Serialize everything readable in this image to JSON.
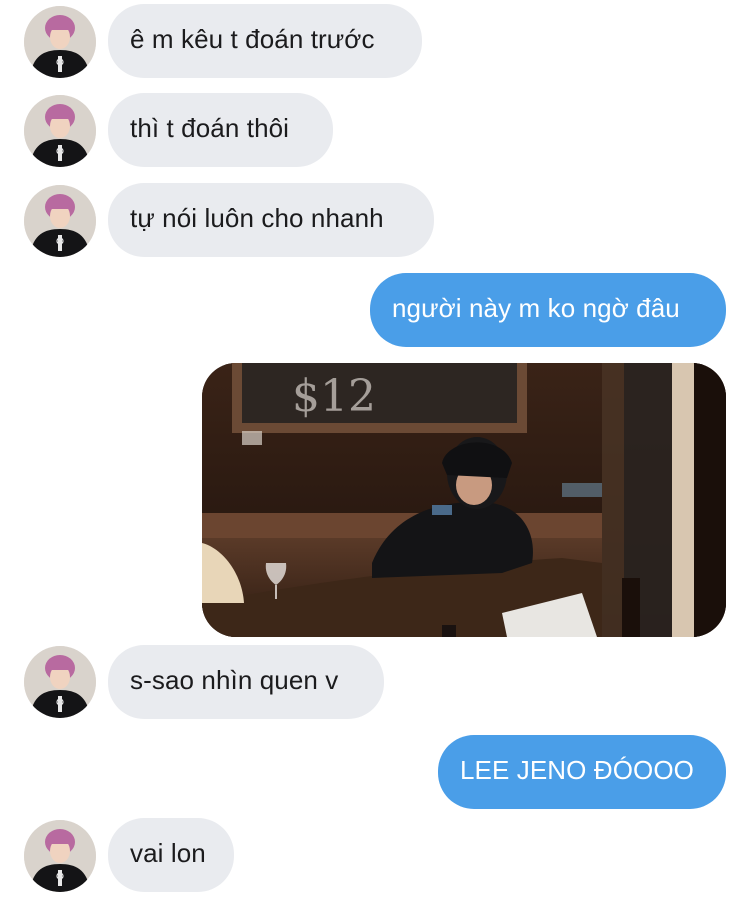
{
  "messages": [
    {
      "side": "incoming",
      "text": "ê m kêu t đoán trước"
    },
    {
      "side": "incoming",
      "text": "thì t đoán thôi"
    },
    {
      "side": "incoming",
      "text": "tự nói luôn cho nhanh"
    },
    {
      "side": "outgoing",
      "text": "người này m ko ngờ đâu"
    },
    {
      "side": "outgoing",
      "type": "photo"
    },
    {
      "side": "incoming",
      "text": "s-sao nhìn quen v"
    },
    {
      "side": "outgoing",
      "text": "LEE JENO ĐÓOOO"
    },
    {
      "side": "incoming",
      "text": "vai lon"
    }
  ],
  "photo": {
    "chalkboard_text": "$12"
  },
  "colors": {
    "incoming_bubble": "#e9ebef",
    "incoming_text": "#1b1b1d",
    "outgoing_bubble": "#4a9ee8",
    "outgoing_text": "#ffffff",
    "background": "#ffffff"
  }
}
